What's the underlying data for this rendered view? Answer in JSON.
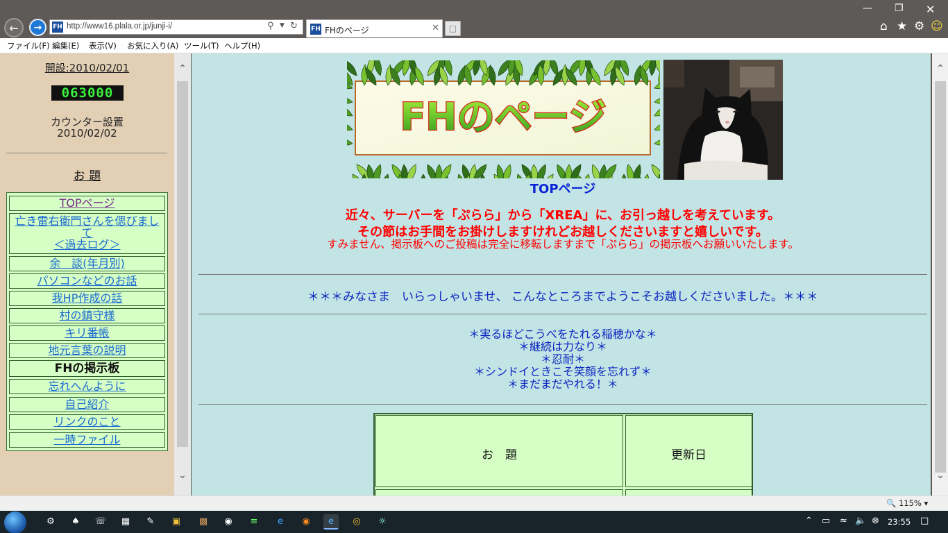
{
  "browser": {
    "favicon_label": "FH",
    "address_url": "http://www16.plala.or.jp/junji-i/",
    "tab_title": "FHのページ",
    "menu": [
      "ファイル(F)",
      "編集(E)",
      "表示(V)",
      "お気に入り(A)",
      "ツール(T)",
      "ヘルプ(H)"
    ],
    "zoom_label": "115%"
  },
  "sidebar": {
    "opened": "開設:2010/02/01",
    "counter": "063000",
    "counter_label": "カウンター設置",
    "counter_date": "2010/02/02",
    "topics_title": "お 題",
    "items": [
      {
        "label": "TOPページ",
        "state": "visited"
      },
      {
        "label": "亡き雷右衛門さんを偲びまして",
        "sub": "＜過去ログ＞",
        "state": "link"
      },
      {
        "label": "余　談(年月別)",
        "state": "link"
      },
      {
        "label": "パソコンなどのお話",
        "state": "link"
      },
      {
        "label": "我HP作成の話",
        "state": "link"
      },
      {
        "label": "村の鎮守様",
        "state": "link"
      },
      {
        "label": "キリ番帳",
        "state": "link"
      },
      {
        "label": "地元言葉の説明",
        "state": "link"
      },
      {
        "label": "FHの掲示板",
        "state": "current"
      },
      {
        "label": "忘れへんように",
        "state": "link"
      },
      {
        "label": "自己紹介",
        "state": "link"
      },
      {
        "label": "リンクのこと",
        "state": "link"
      },
      {
        "label": "一時ファイル",
        "state": "link"
      }
    ]
  },
  "main": {
    "banner_title": "FHのページ",
    "top_link": "TOPページ",
    "notice_lines": [
      "近々、サーバーを「ぷらら」から「XREA」に、お引っ越しを考えています。",
      "その節はお手間をお掛けしますけれどお越しくださいますと嬉しいです。",
      "すみません、掲示板へのご投稿は完全に移転しますまで「ぷらら」の掲示板へお願いいたします。"
    ],
    "welcome": "＊＊＊みなさま　いらっしゃいませ、 こんなところまでようこそお越しくださいました。＊＊＊",
    "mottos": [
      "＊実るほどこうべをたれる稲穂かな＊",
      "＊継続は力なり＊",
      "＊忍耐＊",
      "＊シンドイときこそ笑顔を忘れず＊",
      "＊まだまだやれる！＊"
    ],
    "table_headers": [
      "お　題",
      "更新日"
    ]
  },
  "taskbar": {
    "clock": "23:55"
  },
  "colors": {
    "left_bg": "#e2cfb4",
    "main_bg": "#c2e4e5",
    "nav_cell_bg": "#d6ffc6",
    "link": "#1a6ad0",
    "notice": "#ff0000",
    "welcome": "#0a24c0"
  }
}
